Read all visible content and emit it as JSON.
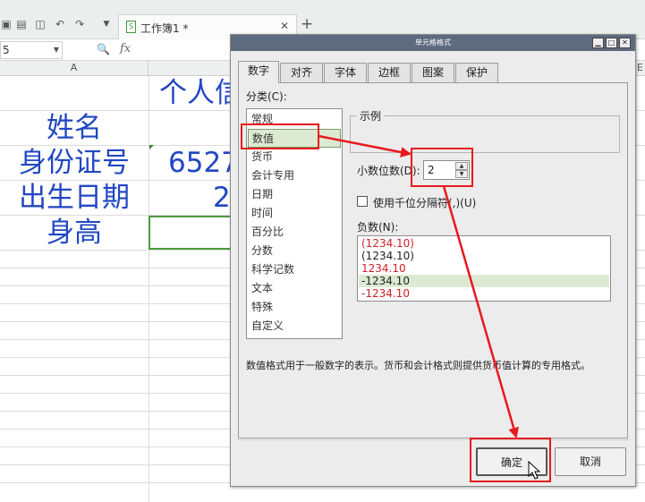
{
  "app": {
    "document_tab_title": "工作簿1 *",
    "name_box_value": "5",
    "fx_label": "fx",
    "column_a_label": "A",
    "column_e_label": "E"
  },
  "sheet": {
    "title_fragment": "个人信",
    "rows": [
      {
        "label": "姓名",
        "value": ""
      },
      {
        "label": "身份证号",
        "value": "6527"
      },
      {
        "label": "出生日期",
        "value": "2"
      },
      {
        "label": "身高",
        "value": ""
      }
    ],
    "text_color": "#2147c2"
  },
  "dialog": {
    "title": "单元格格式",
    "tabs": [
      {
        "label": "数字",
        "active": true
      },
      {
        "label": "对齐"
      },
      {
        "label": "字体"
      },
      {
        "label": "边框"
      },
      {
        "label": "图案"
      },
      {
        "label": "保护"
      }
    ],
    "category_label": "分类(C):",
    "categories": [
      "常规",
      "数值",
      "货币",
      "会计专用",
      "日期",
      "时间",
      "百分比",
      "分数",
      "科学记数",
      "文本",
      "特殊",
      "自定义"
    ],
    "selected_category": "数值",
    "sample_label": "示例",
    "decimal_label": "小数位数(D):",
    "decimal_value": "2",
    "thousands_label": "使用千位分隔符(,)(U)",
    "thousands_checked": false,
    "negative_label": "负数(N):",
    "negative_options": [
      {
        "text": "(1234.10)",
        "color": "#d0202a"
      },
      {
        "text": "(1234.10)",
        "color": "#222222"
      },
      {
        "text": "1234.10",
        "color": "#d0202a"
      },
      {
        "text": "-1234.10",
        "color": "#222222",
        "selected": true
      },
      {
        "text": "-1234.10",
        "color": "#d0202a"
      }
    ],
    "description": "数值格式用于一般数字的表示。货币和会计格式则提供货币值计算的专用格式。",
    "ok_label": "确定",
    "cancel_label": "取消"
  },
  "annotation_color": "#e8191e"
}
